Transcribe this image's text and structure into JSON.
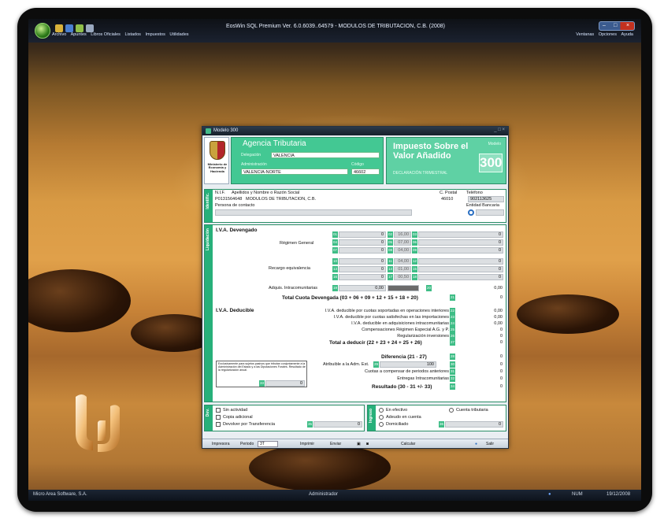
{
  "app": {
    "title": "EosWin SQL Premium Ver. 6.0.6039..64579 - MODULOS DE TRIBUTACION, C.B. (2008)",
    "menu": [
      "Archivo",
      "Apuntes",
      "Libros Oficiales",
      "Listados",
      "Impuestos",
      "Utilidades"
    ],
    "right_menu": [
      "Ventanas",
      "Opciones",
      "Ayuda"
    ]
  },
  "window": {
    "title": "Modelo 300",
    "logo_text": "Ministerio de Economía y Hacienda",
    "agencia": "Agencia Tributaria",
    "delegacion_label": "Delegación",
    "delegacion_value": "VALENCIA",
    "admin_label": "Administración",
    "admin_value": "VALENCIA-NORTE",
    "codigo_label": "Código",
    "codigo_value": "46602",
    "impuesto_title": "Impuesto Sobre el Valor Añadido",
    "declaracion": "DECLARACIÓN TRIMESTRAL",
    "modelo_label": "Modelo",
    "modelo_num": "300"
  },
  "identificacion": {
    "side": "Identific.",
    "nif_label": "N.I.F.",
    "nombre_label": "Apellidos y Nombre o Razón Social",
    "cpostal_label": "C. Postal",
    "telefono_label": "Teléfono",
    "nif_value": "P0131564648",
    "nombre_value": "MODULOS DE TRIBUTACION, C.B.",
    "cpostal_value": "46010",
    "telefono_value": "902113625",
    "contacto_label": "Persona de contacto",
    "entidad_label": "Entidad Bancaria"
  },
  "liquidacion": {
    "side": "Liquidación",
    "devengado_title": "I.V.A. Devengado",
    "regimen_general": "Régimen General",
    "recargo": "Recargo equivalencia",
    "adquis": "Adquis. Intracomunitarias",
    "rows": [
      {
        "b1": "01",
        "v1": "0",
        "b2": "02",
        "pct": "16,00",
        "b3": "03",
        "v3": "0"
      },
      {
        "b1": "04",
        "v1": "0",
        "b2": "05",
        "pct": "07,00",
        "b3": "06",
        "v3": "0"
      },
      {
        "b1": "07",
        "v1": "0",
        "b2": "08",
        "pct": "04,00",
        "b3": "09",
        "v3": "0"
      },
      {
        "b1": "10",
        "v1": "0",
        "b2": "11",
        "pct": "04,00",
        "b3": "12",
        "v3": "0"
      },
      {
        "b1": "13",
        "v1": "0",
        "b2": "14",
        "pct": "01,00",
        "b3": "15",
        "v3": "0"
      },
      {
        "b1": "16",
        "v1": "0",
        "b2": "17",
        "pct": "00,50",
        "b3": "18",
        "v3": "0"
      }
    ],
    "adquis_b1": "19",
    "adquis_v1": "0,00",
    "adquis_b3": "20",
    "adquis_v3": "0,00",
    "total_devengada": "Total Cuota Devengada (03 + 06 + 09 + 12 + 15 + 18 + 20)",
    "total_devengada_box": "21",
    "total_devengada_value": "0",
    "deducible_title": "I.V.A. Deducible",
    "deducibles": [
      {
        "label": "I.V.A. deducible por cuotas soportadas en operaciones interiores",
        "box": "22",
        "value": "0,00"
      },
      {
        "label": "I.V.A. deducible por cuotas satisfechas en las importaciones",
        "box": "23",
        "value": "0,00"
      },
      {
        "label": "I.V.A. deducible en adquisiciones intracomunitarias",
        "box": "24",
        "value": "0,00"
      },
      {
        "label": "Compensaciones Régimen Especial A.G. y P.",
        "box": "25",
        "value": "0"
      },
      {
        "label": "Regularización inversiones",
        "box": "26",
        "value": "0"
      }
    ],
    "total_deducir": "Total a deducir (22 + 23 + 24 + 25 + 26)",
    "total_deducir_box": "27",
    "total_deducir_value": "0",
    "diferencia": "Diferencia (21 - 27)",
    "diferencia_box": "28",
    "diferencia_value": "0",
    "exclusivo": "Exclusivamente para sujetos pasivos que tributan conjuntamente a la Administración del Estado y a las Diputaciones Forales. Resultado de la regularización anual.",
    "excl_box": "33",
    "excl_value": "0",
    "atribuible": "Atribuible a la Adm. Est.",
    "atribuible_box": "29",
    "atribuible_pct": "100",
    "atribuible_box2": "30",
    "atribuible_value": "0",
    "cuotas": "Cuotas a compensar de periodos anteriores",
    "cuotas_box": "31",
    "cuotas_value": "0",
    "entregas": "Entregas Intracomunitarias",
    "entregas_box": "32",
    "entregas_value": "0",
    "resultado": "Resultado (30 - 31 +/- 33)",
    "resultado_box": "34",
    "resultado_value": "0"
  },
  "devolucion": {
    "side": "Dev.",
    "sin_actividad": "Sin actividad",
    "copia": "Copia adicional",
    "devolver": "Devolver por Transferencia",
    "devolver_box": "35",
    "devolver_value": "0"
  },
  "ingreso": {
    "side": "Ingreso",
    "efectivo": "En efectivo",
    "adeudo": "Adeudo en cuenta",
    "domiciliado": "Domiciliado",
    "cuenta": "Cuenta tributaria",
    "box": "36",
    "value": "0"
  },
  "toolbar": {
    "impresora": "Impresora",
    "periodo_label": "Periodo",
    "periodo_value": "3T",
    "imprimir": "Imprimir",
    "enviar": "Enviar",
    "calcular": "Calcular",
    "salir": "Salir"
  },
  "taskbar": {
    "left": "Micro Area Software, S.A.",
    "center": "Administrador",
    "num": "NUM",
    "date": "19/12/2008"
  },
  "colors": {
    "accent": "#43c893",
    "side": "#27b07a",
    "box": "#3ebd86"
  }
}
